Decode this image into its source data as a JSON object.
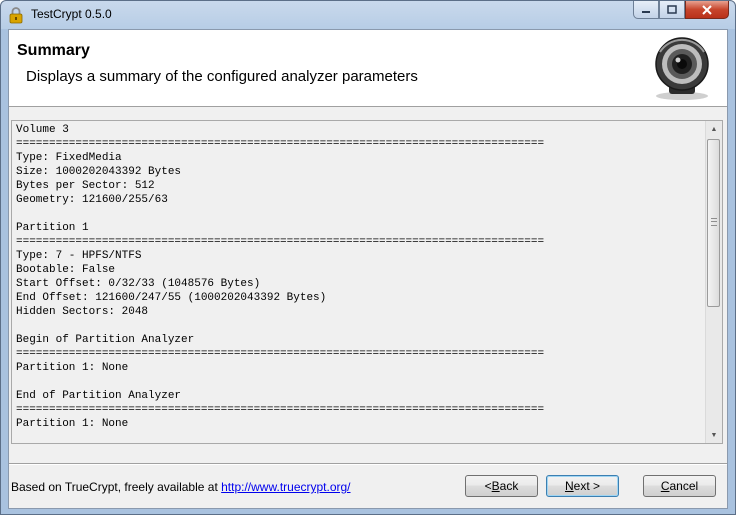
{
  "window": {
    "title": "TestCrypt 0.5.0"
  },
  "header": {
    "title": "Summary",
    "subtitle": "Displays a summary of the configured analyzer parameters",
    "logo_icon": "webcam-lens-icon"
  },
  "summary": {
    "lines": [
      "Volume 3",
      "================================================================================",
      "Type: FixedMedia",
      "Size: 1000202043392 Bytes",
      "Bytes per Sector: 512",
      "Geometry: 121600/255/63",
      "",
      "Partition 1",
      "================================================================================",
      "Type: 7 - HPFS/NTFS",
      "Bootable: False",
      "Start Offset: 0/32/33 (1048576 Bytes)",
      "End Offset: 121600/247/55 (1000202043392 Bytes)",
      "Hidden Sectors: 2048",
      "",
      "Begin of Partition Analyzer",
      "================================================================================",
      "Partition 1: None",
      "",
      "End of Partition Analyzer",
      "================================================================================",
      "Partition 1: None"
    ]
  },
  "footer": {
    "credit_text": "Based on TrueCrypt, freely available at ",
    "credit_link": "http://www.truecrypt.org/"
  },
  "buttons": {
    "back": {
      "mnemonic": "< ",
      "accel": "B",
      "rest": "ack"
    },
    "next": {
      "accel": "N",
      "rest": "ext >"
    },
    "cancel": {
      "accel": "C",
      "rest": "ancel"
    }
  },
  "colors": {
    "link": "#0000ee",
    "close_button": "#c7452c"
  }
}
